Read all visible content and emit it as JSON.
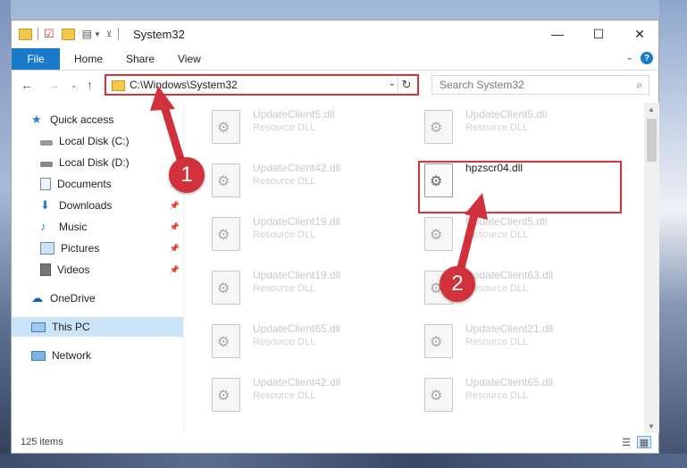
{
  "window": {
    "title": "System32",
    "controls": {
      "minimize": "—",
      "maximize": "☐",
      "close": "✕"
    }
  },
  "ribbon": {
    "file": "File",
    "tabs": [
      "Home",
      "Share",
      "View"
    ],
    "help": "?"
  },
  "nav": {
    "address": "C:\\Windows\\System32",
    "search_placeholder": "Search System32"
  },
  "sidebar": {
    "items": [
      {
        "label": "Quick access",
        "icon": "star-icon",
        "pinned": false
      },
      {
        "label": "Local Disk (C:)",
        "icon": "drive-icon",
        "pinned": true
      },
      {
        "label": "Local Disk (D:)",
        "icon": "drive-icon",
        "pinned": true
      },
      {
        "label": "Documents",
        "icon": "documents-icon",
        "pinned": true
      },
      {
        "label": "Downloads",
        "icon": "download-icon",
        "pinned": true
      },
      {
        "label": "Music",
        "icon": "music-icon",
        "pinned": true
      },
      {
        "label": "Pictures",
        "icon": "pictures-icon",
        "pinned": true
      },
      {
        "label": "Videos",
        "icon": "videos-icon",
        "pinned": true
      },
      {
        "label": "OneDrive",
        "icon": "cloud-icon",
        "pinned": false
      },
      {
        "label": "This PC",
        "icon": "computer-icon",
        "pinned": false,
        "selected": true
      },
      {
        "label": "Network",
        "icon": "network-icon",
        "pinned": false
      }
    ]
  },
  "files": {
    "left": [
      {
        "name": "UpdateClient5.dll",
        "type": "Resource DLL"
      },
      {
        "name": "UpdateClient42.dll",
        "type": "Resource DLL"
      },
      {
        "name": "UpdateClient19.dll",
        "type": "Resource DLL"
      },
      {
        "name": "UpdateClient19.dll",
        "type": "Resource DLL"
      },
      {
        "name": "UpdateClient65.dll",
        "type": "Resource DLL"
      },
      {
        "name": "UpdateClient42.dll",
        "type": "Resource DLL"
      }
    ],
    "right": [
      {
        "name": "UpdateClient5.dll",
        "type": "Resource DLL"
      },
      {
        "name": "hpzscr04.dll",
        "type": ""
      },
      {
        "name": "UpdateClient5.dll",
        "type": "Resource DLL"
      },
      {
        "name": "UpdateClient63.dll",
        "type": "Resource DLL"
      },
      {
        "name": "UpdateClient21.dll",
        "type": "Resource DLL"
      },
      {
        "name": "UpdateClient65.dll",
        "type": "Resource DLL"
      }
    ]
  },
  "status": {
    "item_count": "125 items"
  },
  "annotations": {
    "step1": "1",
    "step2": "2"
  },
  "colors": {
    "accent": "#1979ca",
    "highlight": "#d8323a",
    "selected": "#cce4f7"
  }
}
